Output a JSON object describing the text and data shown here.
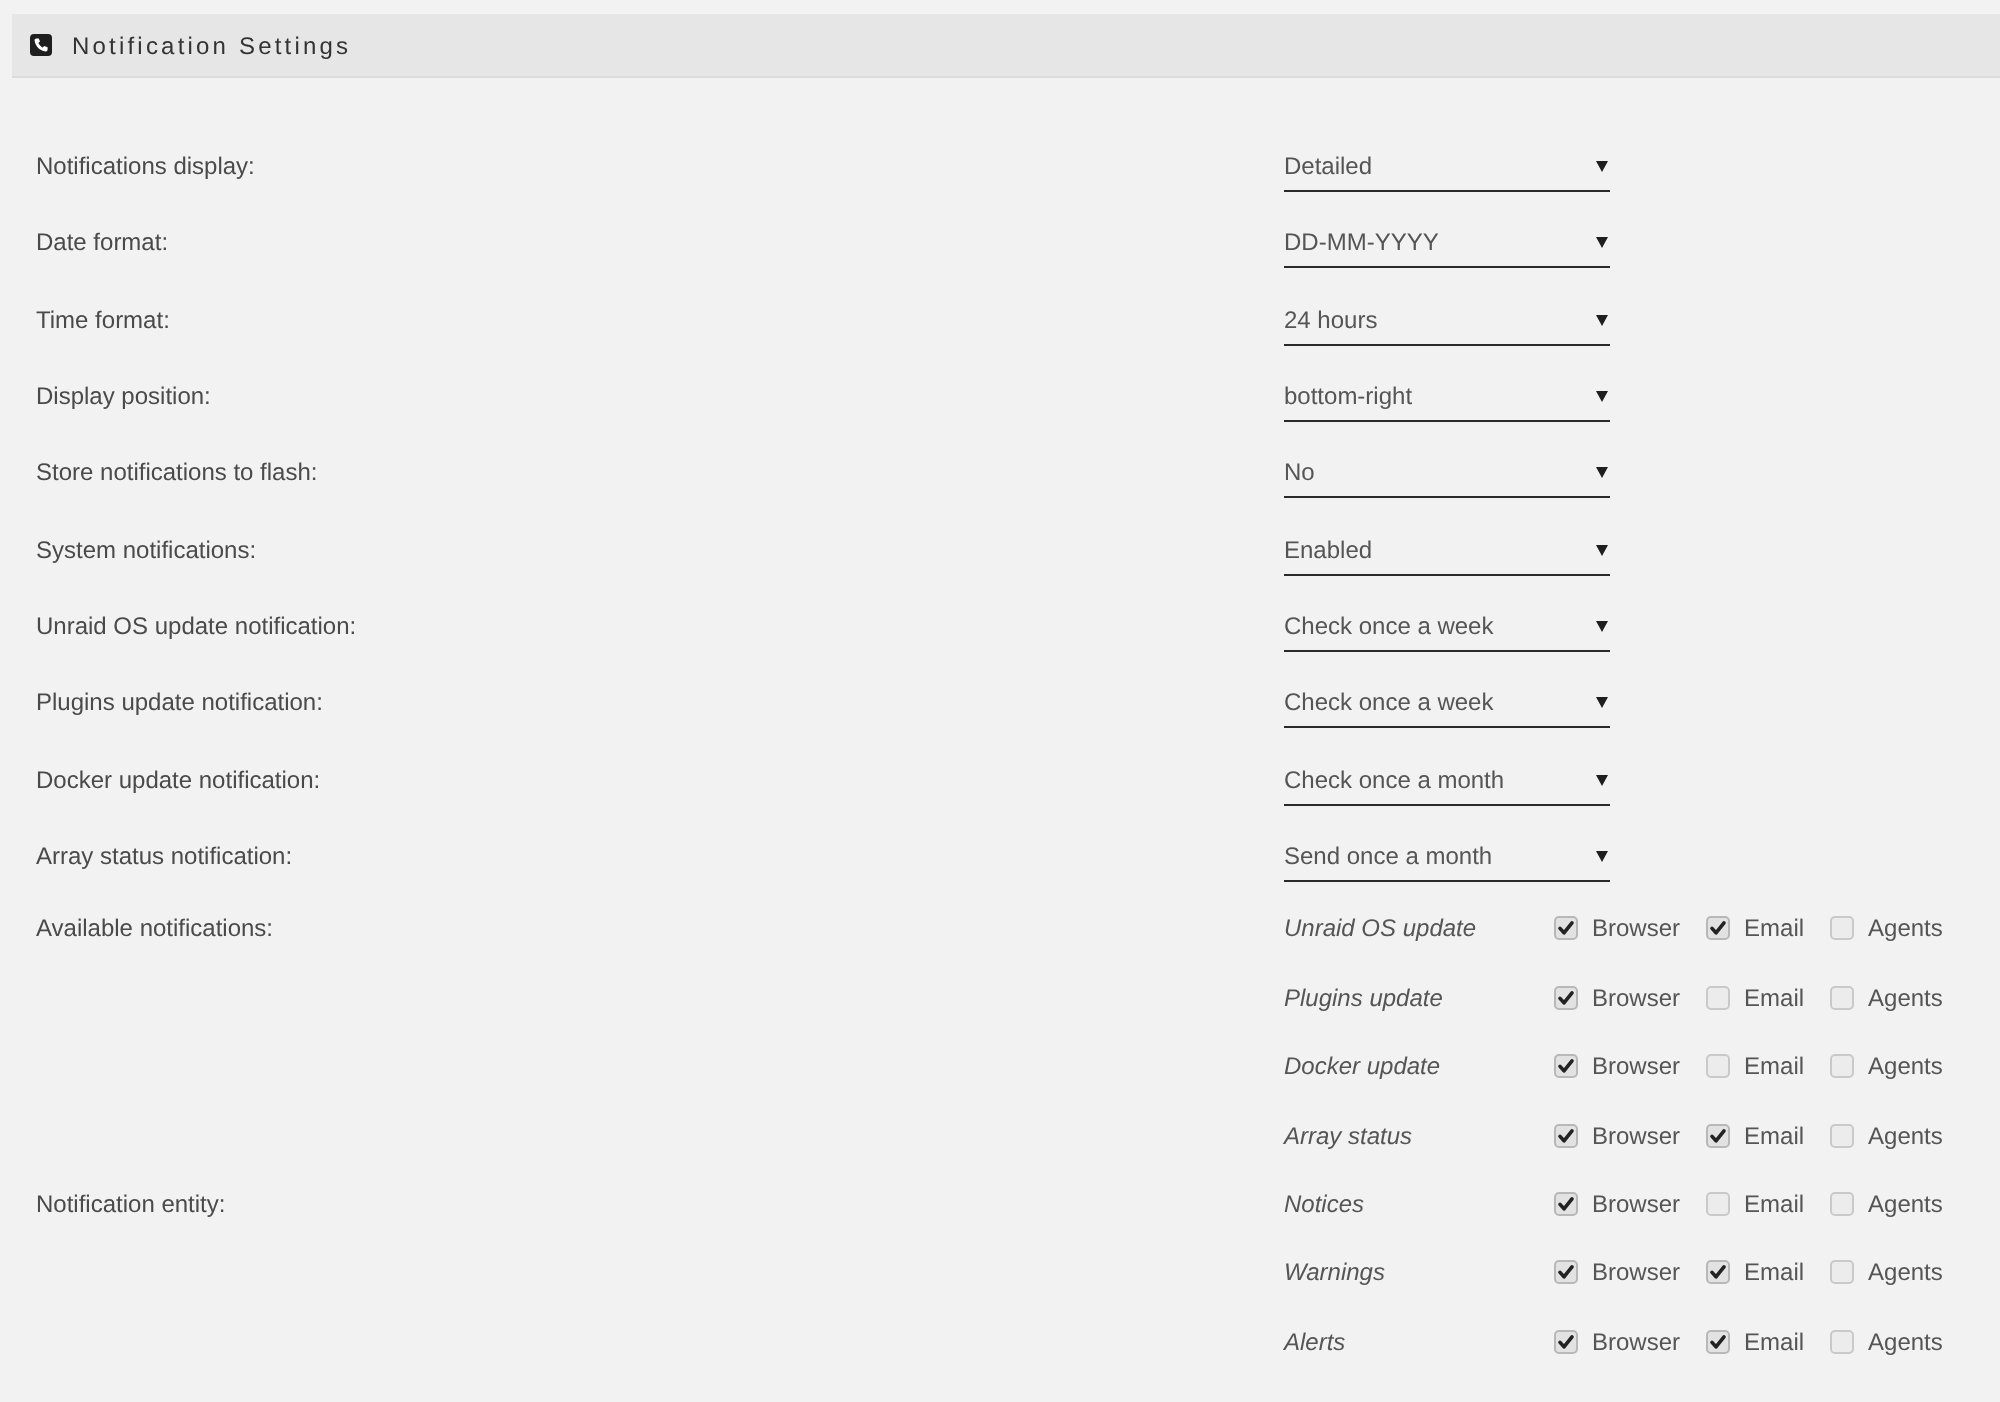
{
  "panel": {
    "title": "Notification Settings"
  },
  "settings": [
    {
      "label": "Notifications display:",
      "value": "Detailed"
    },
    {
      "label": "Date format:",
      "value": "DD-MM-YYYY"
    },
    {
      "label": "Time format:",
      "value": "24 hours"
    },
    {
      "label": "Display position:",
      "value": "bottom-right"
    },
    {
      "label": "Store notifications to flash:",
      "value": "No"
    },
    {
      "label": "System notifications:",
      "value": "Enabled"
    },
    {
      "label": "Unraid OS update notification:",
      "value": "Check once a week"
    },
    {
      "label": "Plugins update notification:",
      "value": "Check once a week"
    },
    {
      "label": "Docker update notification:",
      "value": "Check once a month"
    },
    {
      "label": "Array status notification:",
      "value": "Send once a month"
    }
  ],
  "notification_groups": [
    {
      "label": "Available notifications:",
      "rows": [
        {
          "name": "Unraid OS update",
          "options": [
            {
              "label": "Browser",
              "checked": true
            },
            {
              "label": "Email",
              "checked": true
            },
            {
              "label": "Agents",
              "checked": false
            }
          ]
        },
        {
          "name": "Plugins update",
          "options": [
            {
              "label": "Browser",
              "checked": true
            },
            {
              "label": "Email",
              "checked": false
            },
            {
              "label": "Agents",
              "checked": false
            }
          ]
        },
        {
          "name": "Docker update",
          "options": [
            {
              "label": "Browser",
              "checked": true
            },
            {
              "label": "Email",
              "checked": false
            },
            {
              "label": "Agents",
              "checked": false
            }
          ]
        },
        {
          "name": "Array status",
          "options": [
            {
              "label": "Browser",
              "checked": true
            },
            {
              "label": "Email",
              "checked": true
            },
            {
              "label": "Agents",
              "checked": false
            }
          ]
        }
      ]
    },
    {
      "label": "Notification entity:",
      "rows": [
        {
          "name": "Notices",
          "options": [
            {
              "label": "Browser",
              "checked": true
            },
            {
              "label": "Email",
              "checked": false
            },
            {
              "label": "Agents",
              "checked": false
            }
          ]
        },
        {
          "name": "Warnings",
          "options": [
            {
              "label": "Browser",
              "checked": true
            },
            {
              "label": "Email",
              "checked": true
            },
            {
              "label": "Agents",
              "checked": false
            }
          ]
        },
        {
          "name": "Alerts",
          "options": [
            {
              "label": "Browser",
              "checked": true
            },
            {
              "label": "Email",
              "checked": true
            },
            {
              "label": "Agents",
              "checked": false
            }
          ]
        }
      ]
    }
  ]
}
